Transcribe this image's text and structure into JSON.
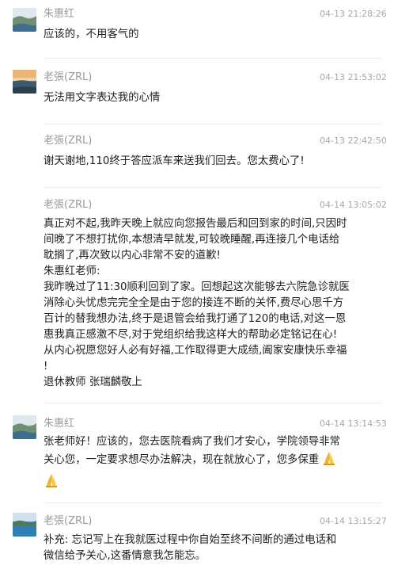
{
  "messages": [
    {
      "sender": "朱惠红",
      "time": "04-13 21:28:26",
      "avatar": "landscape-avatar",
      "lines": [
        "应该的，不用客气的"
      ]
    },
    {
      "sender": "老張(ZRL)",
      "time": "04-13 21:53:02",
      "avatar": "sunset-avatar",
      "lines": [
        "无法用文字表达我的心情"
      ]
    },
    {
      "sender": "老張(ZRL)",
      "time": "04-13 22:42:50",
      "avatar": "",
      "lines": [
        "谢天谢地,110终于答应派车来送我们回去。您太费心了!"
      ]
    },
    {
      "sender": "老張(ZRL)",
      "time": "04-14 13:05:02",
      "avatar": "",
      "lines": [
        "真正对不起,我昨天晚上就应向您报告最后和回到家的时间,只因时",
        "间晚了不想打扰你,本想清早就发,可较晚睡醒,再连接几个电话给",
        "耽搁了,再次致以内心非常不安的道歉!",
        "朱惠红老师:",
        "我昨晚过了11:30顺利回到了家。回想起这次能够去六院急诊就医",
        "消除心头忧虑完完全全是由于您的接连不断的关怀,费尽心思千方",
        "百计的替我想办法,终于是退管会给我打通了120的电话,对这一恩",
        "惠我真正感激不尽,对于党组织给我这样大的帮助必定铭记在心!",
        "从内心祝愿您好人必有好福,工作取得更大成绩,阖家安康快乐幸福",
        "!",
        "退休教师 张瑞麟敬上"
      ]
    },
    {
      "sender": "朱惠红",
      "time": "04-14 13:14:53",
      "avatar": "landscape-avatar",
      "lines": [
        "张老师好！应该的，您去医院看病了我们才安心，学院领导非常",
        "关心您，一定要求想尽办法解决，现在就放心了，您多保重"
      ],
      "emoji": "folded-hands-emoji"
    },
    {
      "sender": "老張(ZRL)",
      "time": "04-14 13:15:27",
      "avatar": "lake-avatar",
      "lines": [
        "补充:   忘记写上在我就医过程中你自始至终不间断的通过电话和",
        "微信给予关心,这番情意我怎能忘。"
      ]
    }
  ]
}
